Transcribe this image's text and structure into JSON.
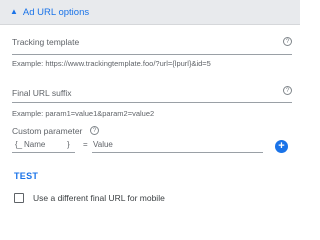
{
  "section": {
    "title": "Ad URL options",
    "toggle_icon": "caret-up-icon"
  },
  "tracking_template": {
    "label": "Tracking template",
    "value": "",
    "help_icon": "help-circle-icon",
    "help_glyph": "?",
    "example": "Example: https://www.trackingtemplate.foo/?url={lpurl}&id=5"
  },
  "final_url_suffix": {
    "label": "Final URL suffix",
    "value": "",
    "help_icon": "help-circle-icon",
    "help_glyph": "?",
    "example": "Example: param1=value1&param2=value2"
  },
  "custom_parameter": {
    "label": "Custom parameter",
    "help_icon": "help-circle-icon",
    "help_glyph": "?",
    "name_prefix": "{_",
    "name_placeholder": "Name",
    "name_suffix": "}",
    "equals": "=",
    "value_placeholder": "Value",
    "add_icon": "plus-circle-icon",
    "add_glyph": "+"
  },
  "test_label": "TEST",
  "mobile_checkbox": {
    "label": "Use a different final URL for mobile",
    "checked": false
  },
  "colors": {
    "accent": "#1a73e8",
    "header_bg": "#e8eaed",
    "text": "#3c4043",
    "muted": "#5f6368"
  }
}
